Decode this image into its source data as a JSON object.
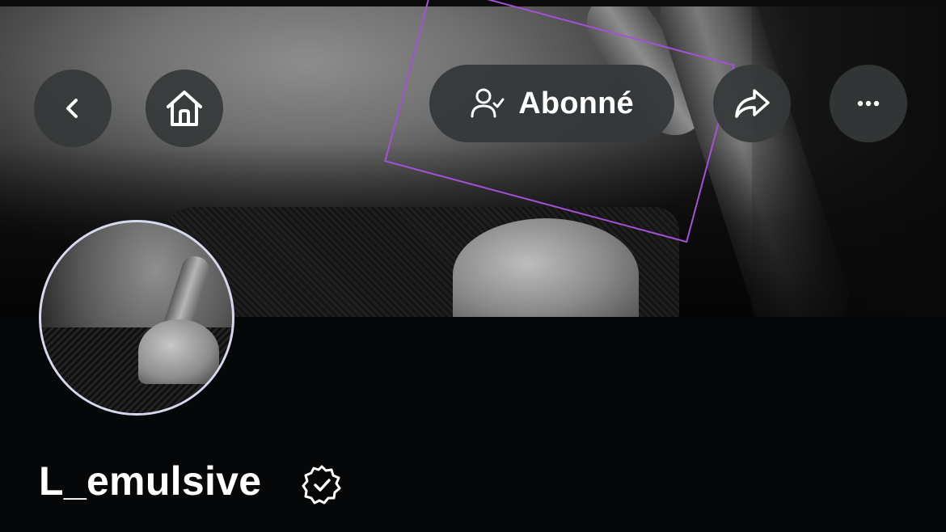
{
  "header": {
    "back_icon": "chevron-left-icon",
    "home_icon": "home-icon",
    "subscribe_button": {
      "label": "Abonné",
      "icon": "person-check-icon"
    },
    "share_icon": "share-arrow-icon",
    "more_icon": "more-horizontal-icon"
  },
  "profile": {
    "display_name": "L_emulsive",
    "verified_icon": "verified-badge-icon"
  },
  "colors": {
    "background": "#060709",
    "button_bg": "#34383A",
    "highlight": "#A550D8",
    "avatar_ring": "#D5D8EE",
    "text": "#FFFFFF"
  }
}
